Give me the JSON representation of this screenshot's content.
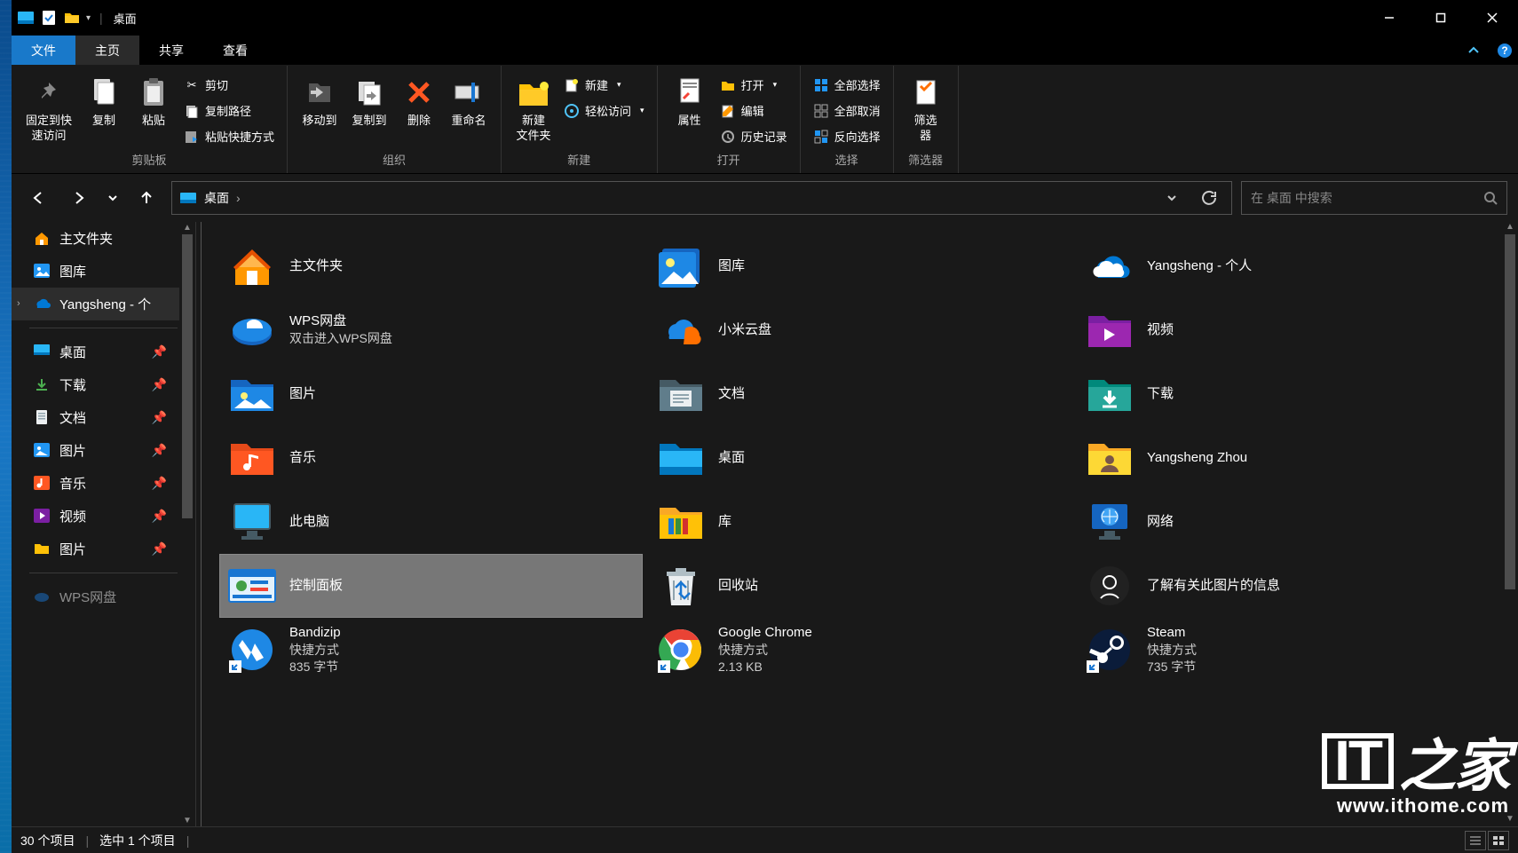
{
  "window": {
    "title": "桌面"
  },
  "tabs": {
    "file": "文件",
    "home": "主页",
    "share": "共享",
    "view": "查看"
  },
  "ribbon": {
    "clipboard": {
      "label": "剪贴板",
      "pin": "固定到快\n速访问",
      "copy": "复制",
      "paste": "粘贴",
      "cut": "剪切",
      "copypath": "复制路径",
      "pasteShortcut": "粘贴快捷方式"
    },
    "organize": {
      "label": "组织",
      "moveTo": "移动到",
      "copyTo": "复制到",
      "delete": "删除",
      "rename": "重命名"
    },
    "new": {
      "label": "新建",
      "newFolder": "新建\n文件夹",
      "newItem": "新建",
      "easyAccess": "轻松访问"
    },
    "open": {
      "label": "打开",
      "properties": "属性",
      "open": "打开",
      "edit": "编辑",
      "history": "历史记录"
    },
    "select": {
      "label": "选择",
      "selectAll": "全部选择",
      "selectNone": "全部取消",
      "invert": "反向选择"
    },
    "filter": {
      "label": "筛选器",
      "btn": "筛选\n器"
    }
  },
  "address": {
    "location": "桌面"
  },
  "search": {
    "placeholder": "在 桌面 中搜索"
  },
  "sidebar": {
    "home": "主文件夹",
    "gallery": "图库",
    "onedrive": "Yangsheng - 个",
    "quick": [
      {
        "label": "桌面",
        "icon": "desktop"
      },
      {
        "label": "下载",
        "icon": "download"
      },
      {
        "label": "文档",
        "icon": "document"
      },
      {
        "label": "图片",
        "icon": "pictures"
      },
      {
        "label": "音乐",
        "icon": "music"
      },
      {
        "label": "视频",
        "icon": "video"
      },
      {
        "label": "图片",
        "icon": "folder"
      }
    ],
    "bottom": "WPS网盘"
  },
  "items": [
    {
      "name": "主文件夹",
      "icon": "home"
    },
    {
      "name": "图库",
      "icon": "gallery"
    },
    {
      "name": "Yangsheng - 个人",
      "icon": "onedrive"
    },
    {
      "name": "WPS网盘",
      "sub": "双击进入WPS网盘",
      "icon": "wps"
    },
    {
      "name": "小米云盘",
      "icon": "xiaomi"
    },
    {
      "name": "视频",
      "icon": "video-folder"
    },
    {
      "name": "图片",
      "icon": "pictures-folder"
    },
    {
      "name": "文档",
      "icon": "docs-folder"
    },
    {
      "name": "下载",
      "icon": "downloads-folder"
    },
    {
      "name": "音乐",
      "icon": "music-folder"
    },
    {
      "name": "桌面",
      "icon": "desktop-folder"
    },
    {
      "name": "Yangsheng Zhou",
      "icon": "user-folder"
    },
    {
      "name": "此电脑",
      "icon": "thispc"
    },
    {
      "name": "库",
      "icon": "libraries"
    },
    {
      "name": "网络",
      "icon": "network"
    },
    {
      "name": "控制面板",
      "icon": "controlpanel",
      "selected": true
    },
    {
      "name": "回收站",
      "icon": "recycle"
    },
    {
      "name": "了解有关此图片的信息",
      "icon": "spotlight"
    },
    {
      "name": "Bandizip",
      "sub": "快捷方式",
      "sub2": "835 字节",
      "icon": "bandizip",
      "shortcut": true
    },
    {
      "name": "Google Chrome",
      "sub": "快捷方式",
      "sub2": "2.13 KB",
      "icon": "chrome",
      "shortcut": true
    },
    {
      "name": "Steam",
      "sub": "快捷方式",
      "sub2": "735 字节",
      "icon": "steam",
      "shortcut": true
    }
  ],
  "status": {
    "count": "30 个项目",
    "selection": "选中 1 个项目"
  },
  "watermark": {
    "text1": "IT",
    "text2": "之家",
    "url": "www.ithome.com"
  }
}
